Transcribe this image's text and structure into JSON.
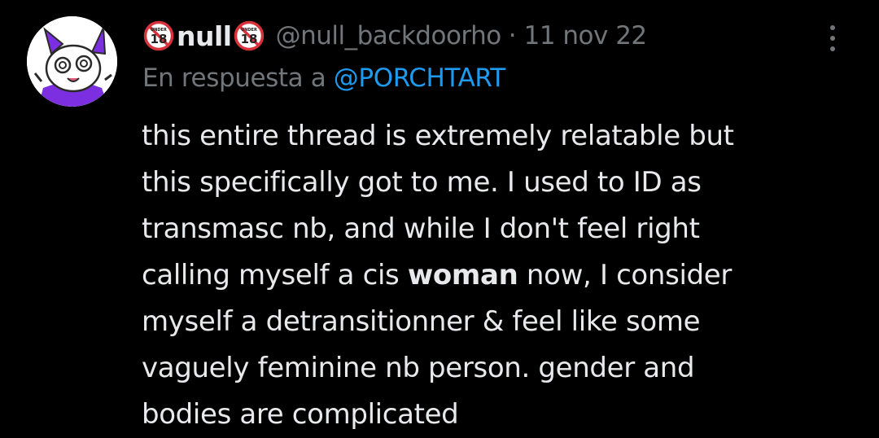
{
  "avatar": {
    "icon": "bunny-avatar",
    "colors": {
      "background": "#ffffff",
      "fur": "#ffffff",
      "accent": "#7b2fe0",
      "outline": "#2a2a2a"
    }
  },
  "author": {
    "badge_icon": "under-18-badge",
    "badge_text": "UNDER",
    "badge_number": "18",
    "name": "null",
    "handle": "@null_backdoorho",
    "separator": "·",
    "date": "11 nov 22"
  },
  "reply_to": {
    "prefix": "En respuesta a",
    "mention": "@PORCHTART"
  },
  "tweet": {
    "lines": [
      {
        "before": "this entire thread is extremely relatable but",
        "bold": "",
        "after": ""
      },
      {
        "before": "this specifically got to me. I used to ID as",
        "bold": "",
        "after": ""
      },
      {
        "before": "transmasc nb, and while I don't feel right",
        "bold": "",
        "after": ""
      },
      {
        "before": "calling myself a cis ",
        "bold": "woman",
        "after": " now, I consider"
      },
      {
        "before": "myself a detransitionner & feel like some",
        "bold": "",
        "after": ""
      },
      {
        "before": "vaguely feminine nb person. gender and",
        "bold": "",
        "after": ""
      },
      {
        "before": "bodies are complicated",
        "bold": "",
        "after": ""
      }
    ]
  },
  "colors": {
    "background": "#000000",
    "text_primary": "#e7e9ea",
    "text_secondary": "#71767b",
    "link": "#1d9bf0",
    "badge_red": "#d8323c"
  },
  "more_menu": {
    "icon": "more-vertical-icon"
  }
}
